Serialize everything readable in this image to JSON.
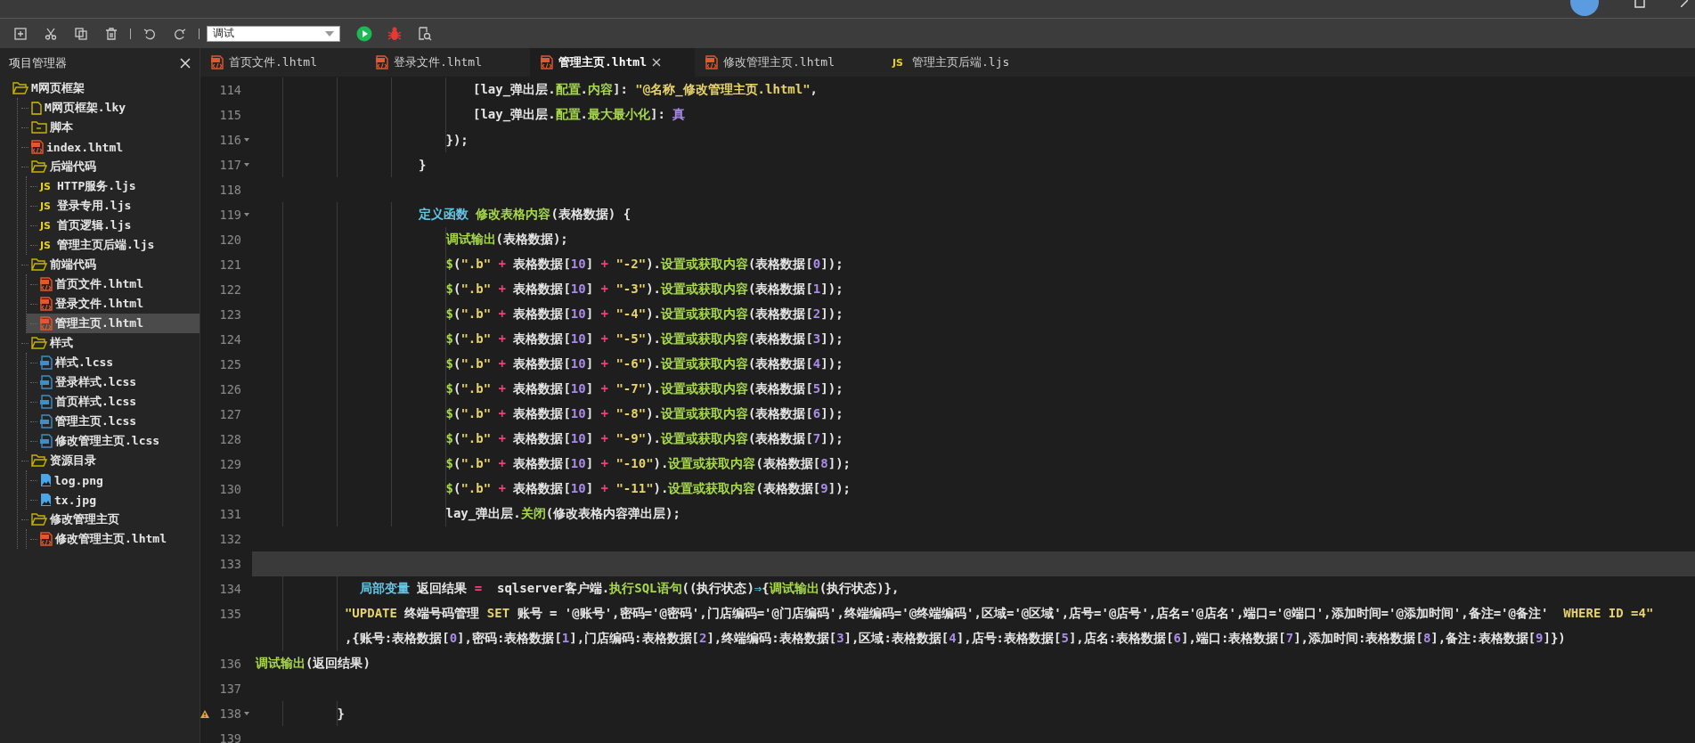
{
  "toolbar": {
    "mode_dropdown": {
      "value": "调试"
    }
  },
  "sidebar": {
    "title": "项目管理器",
    "tree": [
      {
        "label": "M网页框架",
        "kind": "folder",
        "expanded": true,
        "selected": false,
        "children": [
          {
            "label": "M网页框架.lky",
            "kind": "file",
            "selected": false
          },
          {
            "label": "脚本",
            "kind": "folder",
            "expanded": false,
            "selected": false
          },
          {
            "label": "index.lhtml",
            "kind": "html",
            "selected": false
          },
          {
            "label": "后端代码",
            "kind": "folder",
            "expanded": true,
            "selected": false,
            "children": [
              {
                "label": "HTTP服务.ljs",
                "kind": "js",
                "icon_text": "JS",
                "selected": false
              },
              {
                "label": "登录专用.ljs",
                "kind": "js",
                "icon_text": "JS",
                "selected": false
              },
              {
                "label": "首页逻辑.ljs",
                "kind": "js",
                "icon_text": "JS",
                "selected": false
              },
              {
                "label": "管理主页后端.ljs",
                "kind": "js",
                "icon_text": "JS",
                "selected": false
              }
            ]
          },
          {
            "label": "前端代码",
            "kind": "folder",
            "expanded": true,
            "selected": false,
            "children": [
              {
                "label": "首页文件.lhtml",
                "kind": "html",
                "selected": false
              },
              {
                "label": "登录文件.lhtml",
                "kind": "html",
                "selected": false
              },
              {
                "label": "管理主页.lhtml",
                "kind": "html",
                "selected": true
              }
            ]
          },
          {
            "label": "样式",
            "kind": "folder",
            "expanded": true,
            "selected": false,
            "children": [
              {
                "label": "样式.lcss",
                "kind": "css",
                "selected": false
              },
              {
                "label": "登录样式.lcss",
                "kind": "css",
                "selected": false
              },
              {
                "label": "首页样式.lcss",
                "kind": "css",
                "selected": false
              },
              {
                "label": "管理主页.lcss",
                "kind": "css",
                "selected": false
              },
              {
                "label": "修改管理主页.lcss",
                "kind": "css",
                "selected": false
              }
            ]
          },
          {
            "label": "资源目录",
            "kind": "folder",
            "expanded": true,
            "selected": false,
            "children": [
              {
                "label": "log.png",
                "kind": "image",
                "selected": false
              },
              {
                "label": "tx.jpg",
                "kind": "image",
                "selected": false
              }
            ]
          },
          {
            "label": "修改管理主页",
            "kind": "folder",
            "expanded": true,
            "selected": false,
            "children": [
              {
                "label": "修改管理主页.lhtml",
                "kind": "html",
                "selected": false
              }
            ]
          }
        ]
      }
    ]
  },
  "tabs": [
    {
      "label": "首页文件.lhtml",
      "kind": "html",
      "selected": false,
      "closable": false
    },
    {
      "label": "登录文件.lhtml",
      "kind": "html",
      "selected": false,
      "closable": false
    },
    {
      "label": "管理主页.lhtml",
      "kind": "html",
      "selected": true,
      "closable": true
    },
    {
      "label": "修改管理主页.lhtml",
      "kind": "html",
      "selected": false,
      "closable": false
    },
    {
      "label": "管理主页后端.ljs",
      "kind": "js",
      "icon_text": "JS",
      "selected": false,
      "closable": false
    }
  ],
  "editor": {
    "lines": [
      {
        "number": "114",
        "fold": false,
        "warning": false,
        "current": false,
        "tokens": [
          {
            "kind": "plain",
            "text": "\t\t\t\t\t\t\t\t[lay_弹出层."
          },
          {
            "kind": "func",
            "text": "配置"
          },
          {
            "kind": "plain",
            "text": "."
          },
          {
            "kind": "func",
            "text": "内容"
          },
          {
            "kind": "plain",
            "text": "]: "
          },
          {
            "kind": "string",
            "text": "\"@名称_修改管理主页.lhtml\""
          },
          {
            "kind": "plain",
            "text": ","
          }
        ]
      },
      {
        "number": "115",
        "fold": false,
        "warning": false,
        "current": false,
        "tokens": [
          {
            "kind": "plain",
            "text": "\t\t\t\t\t\t\t\t[lay_弹出层."
          },
          {
            "kind": "func",
            "text": "配置"
          },
          {
            "kind": "plain",
            "text": "."
          },
          {
            "kind": "func",
            "text": "最大最小化"
          },
          {
            "kind": "plain",
            "text": "]: "
          },
          {
            "kind": "number",
            "text": "真"
          }
        ]
      },
      {
        "number": "116",
        "fold": true,
        "warning": false,
        "current": false,
        "tokens": [
          {
            "kind": "plain",
            "text": "\t\t\t\t\t\t\t});"
          }
        ]
      },
      {
        "number": "117",
        "fold": true,
        "warning": false,
        "current": false,
        "tokens": [
          {
            "kind": "plain",
            "text": "\t\t\t\t\t\t}"
          }
        ]
      },
      {
        "number": "118",
        "fold": false,
        "warning": false,
        "current": false
      },
      {
        "number": "119",
        "fold": true,
        "warning": false,
        "current": false,
        "tokens": [
          {
            "kind": "keyword",
            "text": "\t\t\t\t\t\t定义函数"
          },
          {
            "kind": "func",
            "text": " 修改表格内容"
          },
          {
            "kind": "plain",
            "text": "(表格数据) {"
          }
        ]
      },
      {
        "number": "120",
        "fold": false,
        "warning": false,
        "current": false,
        "tokens": [
          {
            "kind": "func",
            "text": "\t\t\t\t\t\t\t调试输出"
          },
          {
            "kind": "plain",
            "text": "(表格数据);"
          }
        ]
      },
      {
        "number": "121",
        "fold": false,
        "warning": false,
        "current": false,
        "tokens": [
          {
            "kind": "func",
            "text": "\t\t\t\t\t\t\t$"
          },
          {
            "kind": "plain",
            "text": "("
          },
          {
            "kind": "string",
            "text": "\".b\""
          },
          {
            "kind": "op",
            "text": " + "
          },
          {
            "kind": "plain",
            "text": "表格数据["
          },
          {
            "kind": "number",
            "text": "10"
          },
          {
            "kind": "plain",
            "text": "] "
          },
          {
            "kind": "op",
            "text": "+"
          },
          {
            "kind": "string",
            "text": " \"-2\""
          },
          {
            "kind": "plain",
            "text": ")."
          },
          {
            "kind": "func",
            "text": "设置或获取内容"
          },
          {
            "kind": "plain",
            "text": "(表格数据["
          },
          {
            "kind": "number",
            "text": "0"
          },
          {
            "kind": "plain",
            "text": "]);"
          }
        ]
      },
      {
        "number": "122",
        "fold": false,
        "warning": false,
        "current": false,
        "tokens": [
          {
            "kind": "func",
            "text": "\t\t\t\t\t\t\t$"
          },
          {
            "kind": "plain",
            "text": "("
          },
          {
            "kind": "string",
            "text": "\".b\""
          },
          {
            "kind": "op",
            "text": " + "
          },
          {
            "kind": "plain",
            "text": "表格数据["
          },
          {
            "kind": "number",
            "text": "10"
          },
          {
            "kind": "plain",
            "text": "] "
          },
          {
            "kind": "op",
            "text": "+"
          },
          {
            "kind": "string",
            "text": " \"-3\""
          },
          {
            "kind": "plain",
            "text": ")."
          },
          {
            "kind": "func",
            "text": "设置或获取内容"
          },
          {
            "kind": "plain",
            "text": "(表格数据["
          },
          {
            "kind": "number",
            "text": "1"
          },
          {
            "kind": "plain",
            "text": "]);"
          }
        ]
      },
      {
        "number": "123",
        "fold": false,
        "warning": false,
        "current": false,
        "tokens": [
          {
            "kind": "func",
            "text": "\t\t\t\t\t\t\t$"
          },
          {
            "kind": "plain",
            "text": "("
          },
          {
            "kind": "string",
            "text": "\".b\""
          },
          {
            "kind": "op",
            "text": " + "
          },
          {
            "kind": "plain",
            "text": "表格数据["
          },
          {
            "kind": "number",
            "text": "10"
          },
          {
            "kind": "plain",
            "text": "] "
          },
          {
            "kind": "op",
            "text": "+"
          },
          {
            "kind": "string",
            "text": " \"-4\""
          },
          {
            "kind": "plain",
            "text": ")."
          },
          {
            "kind": "func",
            "text": "设置或获取内容"
          },
          {
            "kind": "plain",
            "text": "(表格数据["
          },
          {
            "kind": "number",
            "text": "2"
          },
          {
            "kind": "plain",
            "text": "]);"
          }
        ]
      },
      {
        "number": "124",
        "fold": false,
        "warning": false,
        "current": false,
        "tokens": [
          {
            "kind": "func",
            "text": "\t\t\t\t\t\t\t$"
          },
          {
            "kind": "plain",
            "text": "("
          },
          {
            "kind": "string",
            "text": "\".b\""
          },
          {
            "kind": "op",
            "text": " + "
          },
          {
            "kind": "plain",
            "text": "表格数据["
          },
          {
            "kind": "number",
            "text": "10"
          },
          {
            "kind": "plain",
            "text": "] "
          },
          {
            "kind": "op",
            "text": "+"
          },
          {
            "kind": "string",
            "text": " \"-5\""
          },
          {
            "kind": "plain",
            "text": ")."
          },
          {
            "kind": "func",
            "text": "设置或获取内容"
          },
          {
            "kind": "plain",
            "text": "(表格数据["
          },
          {
            "kind": "number",
            "text": "3"
          },
          {
            "kind": "plain",
            "text": "]);"
          }
        ]
      },
      {
        "number": "125",
        "fold": false,
        "warning": false,
        "current": false,
        "tokens": [
          {
            "kind": "func",
            "text": "\t\t\t\t\t\t\t$"
          },
          {
            "kind": "plain",
            "text": "("
          },
          {
            "kind": "string",
            "text": "\".b\""
          },
          {
            "kind": "op",
            "text": " + "
          },
          {
            "kind": "plain",
            "text": "表格数据["
          },
          {
            "kind": "number",
            "text": "10"
          },
          {
            "kind": "plain",
            "text": "] "
          },
          {
            "kind": "op",
            "text": "+"
          },
          {
            "kind": "string",
            "text": " \"-6\""
          },
          {
            "kind": "plain",
            "text": ")."
          },
          {
            "kind": "func",
            "text": "设置或获取内容"
          },
          {
            "kind": "plain",
            "text": "(表格数据["
          },
          {
            "kind": "number",
            "text": "4"
          },
          {
            "kind": "plain",
            "text": "]);"
          }
        ]
      },
      {
        "number": "126",
        "fold": false,
        "warning": false,
        "current": false,
        "tokens": [
          {
            "kind": "func",
            "text": "\t\t\t\t\t\t\t$"
          },
          {
            "kind": "plain",
            "text": "("
          },
          {
            "kind": "string",
            "text": "\".b\""
          },
          {
            "kind": "op",
            "text": " + "
          },
          {
            "kind": "plain",
            "text": "表格数据["
          },
          {
            "kind": "number",
            "text": "10"
          },
          {
            "kind": "plain",
            "text": "] "
          },
          {
            "kind": "op",
            "text": "+"
          },
          {
            "kind": "string",
            "text": " \"-7\""
          },
          {
            "kind": "plain",
            "text": ")."
          },
          {
            "kind": "func",
            "text": "设置或获取内容"
          },
          {
            "kind": "plain",
            "text": "(表格数据["
          },
          {
            "kind": "number",
            "text": "5"
          },
          {
            "kind": "plain",
            "text": "]);"
          }
        ]
      },
      {
        "number": "127",
        "fold": false,
        "warning": false,
        "current": false,
        "tokens": [
          {
            "kind": "func",
            "text": "\t\t\t\t\t\t\t$"
          },
          {
            "kind": "plain",
            "text": "("
          },
          {
            "kind": "string",
            "text": "\".b\""
          },
          {
            "kind": "op",
            "text": " + "
          },
          {
            "kind": "plain",
            "text": "表格数据["
          },
          {
            "kind": "number",
            "text": "10"
          },
          {
            "kind": "plain",
            "text": "] "
          },
          {
            "kind": "op",
            "text": "+"
          },
          {
            "kind": "string",
            "text": " \"-8\""
          },
          {
            "kind": "plain",
            "text": ")."
          },
          {
            "kind": "func",
            "text": "设置或获取内容"
          },
          {
            "kind": "plain",
            "text": "(表格数据["
          },
          {
            "kind": "number",
            "text": "6"
          },
          {
            "kind": "plain",
            "text": "]);"
          }
        ]
      },
      {
        "number": "128",
        "fold": false,
        "warning": false,
        "current": false,
        "tokens": [
          {
            "kind": "func",
            "text": "\t\t\t\t\t\t\t$"
          },
          {
            "kind": "plain",
            "text": "("
          },
          {
            "kind": "string",
            "text": "\".b\""
          },
          {
            "kind": "op",
            "text": " + "
          },
          {
            "kind": "plain",
            "text": "表格数据["
          },
          {
            "kind": "number",
            "text": "10"
          },
          {
            "kind": "plain",
            "text": "] "
          },
          {
            "kind": "op",
            "text": "+"
          },
          {
            "kind": "string",
            "text": " \"-9\""
          },
          {
            "kind": "plain",
            "text": ")."
          },
          {
            "kind": "func",
            "text": "设置或获取内容"
          },
          {
            "kind": "plain",
            "text": "(表格数据["
          },
          {
            "kind": "number",
            "text": "7"
          },
          {
            "kind": "plain",
            "text": "]);"
          }
        ]
      },
      {
        "number": "129",
        "fold": false,
        "warning": false,
        "current": false,
        "tokens": [
          {
            "kind": "func",
            "text": "\t\t\t\t\t\t\t$"
          },
          {
            "kind": "plain",
            "text": "("
          },
          {
            "kind": "string",
            "text": "\".b\""
          },
          {
            "kind": "op",
            "text": " + "
          },
          {
            "kind": "plain",
            "text": "表格数据["
          },
          {
            "kind": "number",
            "text": "10"
          },
          {
            "kind": "plain",
            "text": "] "
          },
          {
            "kind": "op",
            "text": "+"
          },
          {
            "kind": "string",
            "text": " \"-10\""
          },
          {
            "kind": "plain",
            "text": ")."
          },
          {
            "kind": "func",
            "text": "设置或获取内容"
          },
          {
            "kind": "plain",
            "text": "(表格数据["
          },
          {
            "kind": "number",
            "text": "8"
          },
          {
            "kind": "plain",
            "text": "]);"
          }
        ]
      },
      {
        "number": "130",
        "fold": false,
        "warning": false,
        "current": false,
        "tokens": [
          {
            "kind": "func",
            "text": "\t\t\t\t\t\t\t$"
          },
          {
            "kind": "plain",
            "text": "("
          },
          {
            "kind": "string",
            "text": "\".b\""
          },
          {
            "kind": "op",
            "text": " + "
          },
          {
            "kind": "plain",
            "text": "表格数据["
          },
          {
            "kind": "number",
            "text": "10"
          },
          {
            "kind": "plain",
            "text": "] "
          },
          {
            "kind": "op",
            "text": "+"
          },
          {
            "kind": "string",
            "text": " \"-11\""
          },
          {
            "kind": "plain",
            "text": ")."
          },
          {
            "kind": "func",
            "text": "设置或获取内容"
          },
          {
            "kind": "plain",
            "text": "(表格数据["
          },
          {
            "kind": "number",
            "text": "9"
          },
          {
            "kind": "plain",
            "text": "]);"
          }
        ]
      },
      {
        "number": "131",
        "fold": false,
        "warning": false,
        "current": false,
        "tokens": [
          {
            "kind": "plain",
            "text": "\t\t\t\t\t\t\tlay_弹出层."
          },
          {
            "kind": "func",
            "text": "关闭"
          },
          {
            "kind": "plain",
            "text": "(修改表格内容弹出层);"
          }
        ]
      },
      {
        "number": "132",
        "fold": false,
        "warning": false,
        "current": false
      },
      {
        "number": "133",
        "fold": false,
        "warning": false,
        "current": true
      },
      {
        "number": "134",
        "fold": false,
        "warning": false,
        "current": false,
        "tokens": [
          {
            "kind": "keyword",
            "text": "\t\t\t   局部变量"
          },
          {
            "kind": "plain",
            "text": " 返回结果 "
          },
          {
            "kind": "op",
            "text": "="
          },
          {
            "kind": "plain",
            "text": "  sqlserver客户端."
          },
          {
            "kind": "func",
            "text": "执行SQL语句"
          },
          {
            "kind": "plain",
            "text": "((执行状态)"
          },
          {
            "kind": "keyword",
            "text": "⇒"
          },
          {
            "kind": "plain",
            "text": "{"
          },
          {
            "kind": "func",
            "text": "调试输出"
          },
          {
            "kind": "plain",
            "text": "(执行状态)},"
          }
        ]
      },
      {
        "number": "135",
        "fold": false,
        "warning": false,
        "current": false,
        "tokens": [
          {
            "kind": "string",
            "text": "\t\t\t \"UPDATE"
          },
          {
            "kind": "plain",
            "text": " 终端号码管理 "
          },
          {
            "kind": "string",
            "text": "SET"
          },
          {
            "kind": "plain",
            "text": " 账号 = '@账号',密码='@密码',门店编码='@门店编码',终端编码='@终端编码',区域='@区域',店号='@店号',店名='@店名',端口='@端口',添加时间='@添加时间',备注='@备注'  "
          },
          {
            "kind": "string",
            "text": "WHERE ID =4\""
          }
        ],
        "continuation": [
          {
            "kind": "plain",
            "text": "\t\t\t ,{账号:表格数据["
          },
          {
            "kind": "number",
            "text": "0"
          },
          {
            "kind": "plain",
            "text": "],密码:表格数据["
          },
          {
            "kind": "number",
            "text": "1"
          },
          {
            "kind": "plain",
            "text": "],门店编码:表格数据["
          },
          {
            "kind": "number",
            "text": "2"
          },
          {
            "kind": "plain",
            "text": "],终端编码:表格数据["
          },
          {
            "kind": "number",
            "text": "3"
          },
          {
            "kind": "plain",
            "text": "],区域:表格数据["
          },
          {
            "kind": "number",
            "text": "4"
          },
          {
            "kind": "plain",
            "text": "],店号:表格数据["
          },
          {
            "kind": "number",
            "text": "5"
          },
          {
            "kind": "plain",
            "text": "],店名:表格数据["
          },
          {
            "kind": "number",
            "text": "6"
          },
          {
            "kind": "plain",
            "text": "],端口:表格数据["
          },
          {
            "kind": "number",
            "text": "7"
          },
          {
            "kind": "plain",
            "text": "],添加时间:表格数据["
          },
          {
            "kind": "number",
            "text": "8"
          },
          {
            "kind": "plain",
            "text": "],备注:表格数据["
          },
          {
            "kind": "number",
            "text": "9"
          },
          {
            "kind": "plain",
            "text": "]})"
          }
        ]
      },
      {
        "number": "136",
        "fold": false,
        "warning": false,
        "current": false,
        "tokens": [
          {
            "kind": "func",
            "text": "调试输出"
          },
          {
            "kind": "plain",
            "text": "(返回结果)"
          }
        ]
      },
      {
        "number": "137",
        "fold": false,
        "warning": false,
        "current": false
      },
      {
        "number": "138",
        "fold": true,
        "warning": true,
        "current": false,
        "tokens": [
          {
            "kind": "plain",
            "text": "\t\t\t}"
          }
        ]
      },
      {
        "number": "139",
        "fold": false,
        "warning": false,
        "current": false
      }
    ]
  }
}
